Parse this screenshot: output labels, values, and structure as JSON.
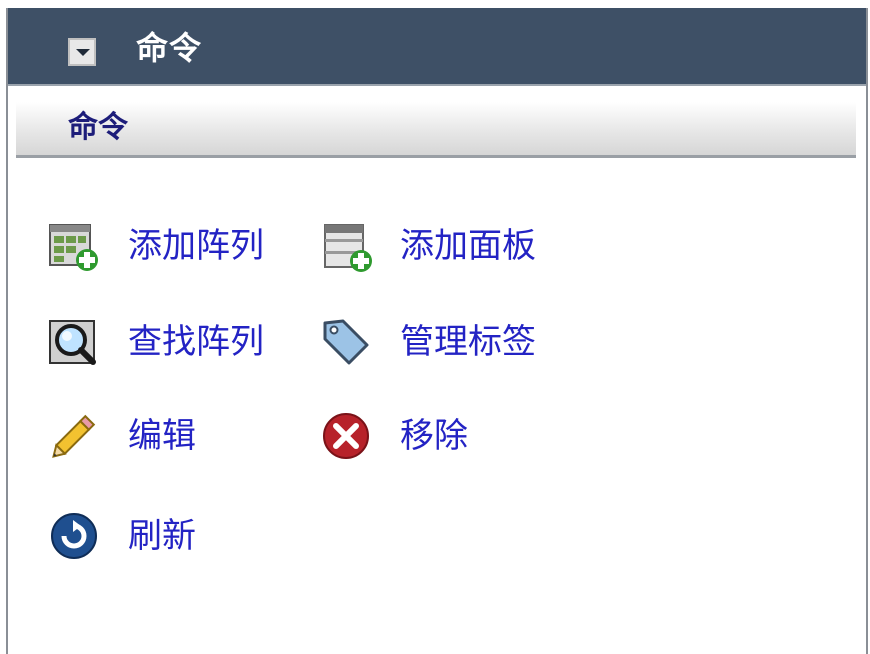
{
  "header": {
    "title": "命令",
    "collapse_icon": "chevron-down-icon"
  },
  "section": {
    "title": "命令"
  },
  "commands": [
    {
      "label": "添加阵列",
      "icon": "add-array-icon"
    },
    {
      "label": "添加面板",
      "icon": "add-panel-icon"
    },
    {
      "label": "查找阵列",
      "icon": "find-array-icon"
    },
    {
      "label": "管理标签",
      "icon": "tag-icon"
    },
    {
      "label": "编辑",
      "icon": "pencil-icon"
    },
    {
      "label": "移除",
      "icon": "remove-icon"
    },
    {
      "label": "刷新",
      "icon": "refresh-icon"
    }
  ],
  "colors": {
    "header_bg": "#3e5066",
    "link": "#2323c4",
    "section_title": "#1d1d7a"
  }
}
